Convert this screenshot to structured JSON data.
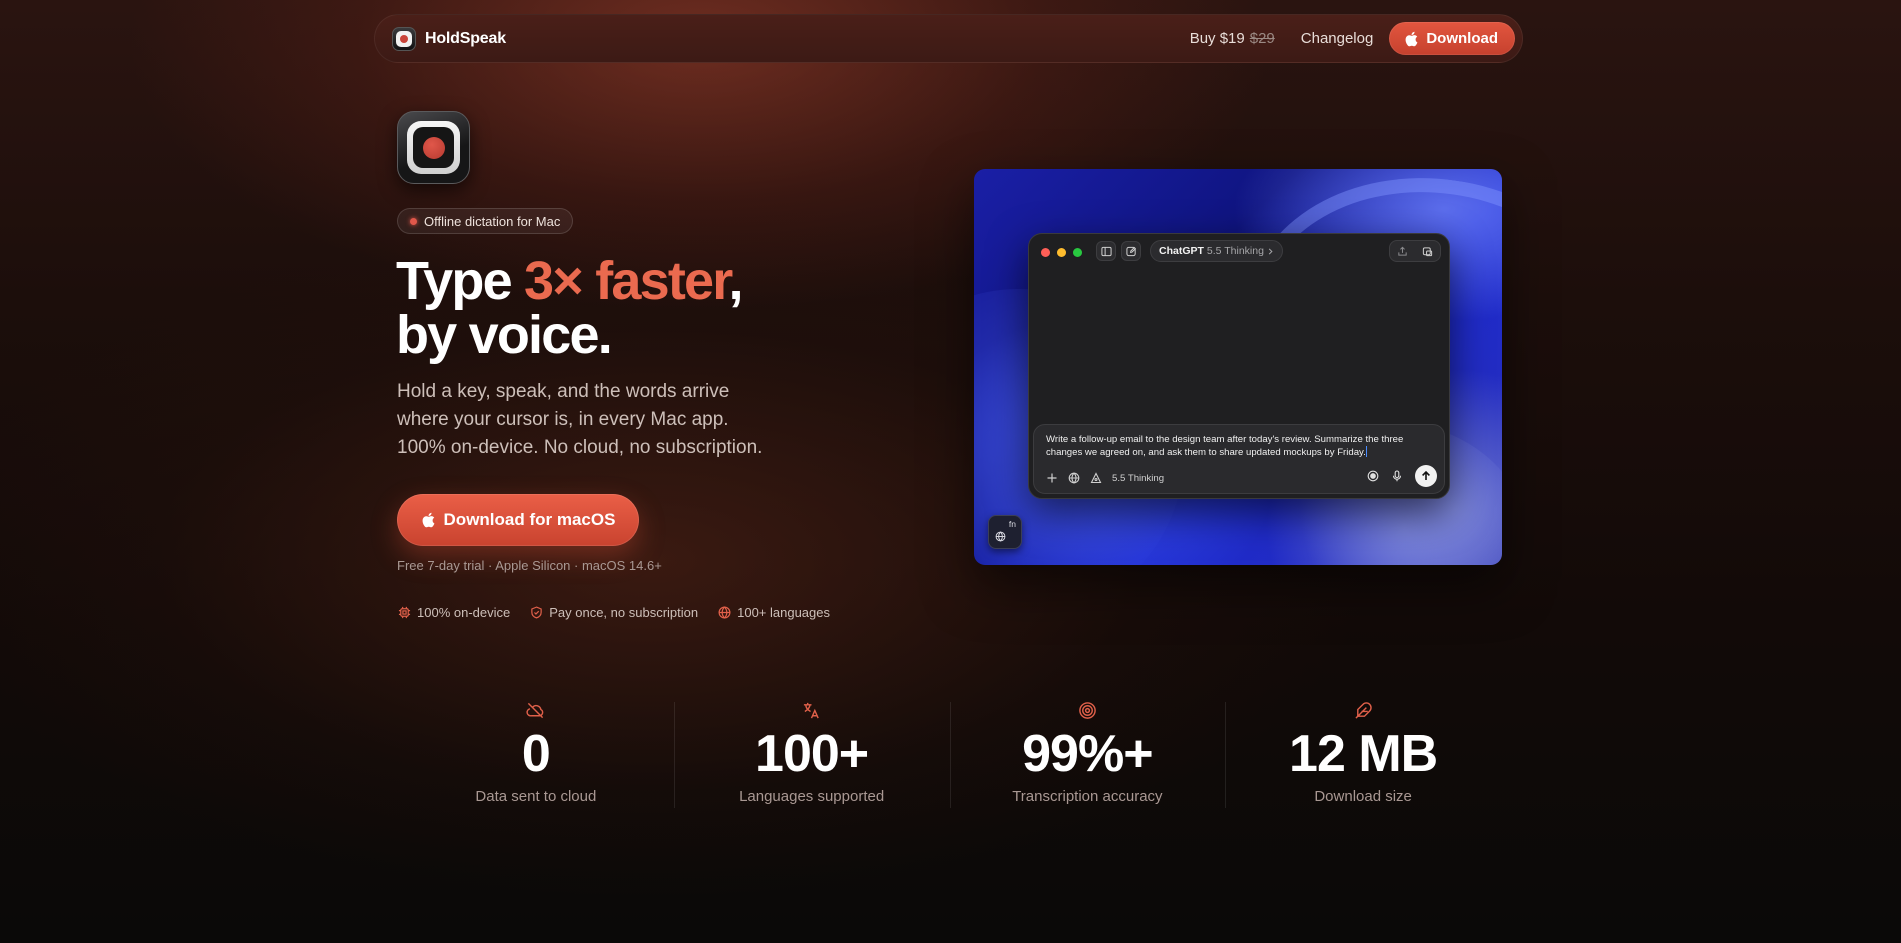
{
  "nav": {
    "brand": "HoldSpeak",
    "buy_label": "Buy $19",
    "old_price": "$29",
    "changelog": "Changelog",
    "download": "Download"
  },
  "hero": {
    "badge": "Offline dictation for Mac",
    "headline_part1": "Type ",
    "headline_accent": "3× faster",
    "headline_part2": ",",
    "headline_line2": "by voice.",
    "subtitle_line1": "Hold a key, speak, and the words arrive",
    "subtitle_line2": "where your cursor is, in every Mac app.",
    "subtitle_line3": "100% on-device. No cloud, no subscription.",
    "cta": "Download for macOS",
    "trial": "Free 7-day trial · Apple Silicon · macOS 14.6+",
    "features": [
      {
        "label": "100% on-device",
        "icon": "chip-icon"
      },
      {
        "label": "Pay once, no subscription",
        "icon": "shield-check-icon"
      },
      {
        "label": "100+ languages",
        "icon": "globe-icon"
      }
    ]
  },
  "demo": {
    "app_name": "ChatGPT",
    "model": "5.5 Thinking",
    "prompt_text": "Write a follow-up email to the design team after today's review. Summarize the three changes we agreed on, and ask them to share updated mockups by Friday.",
    "composer_model": "5.5 Thinking",
    "fn_label": "fn"
  },
  "stats": [
    {
      "value": "0",
      "label": "Data sent to cloud",
      "icon": "cloud-off-icon"
    },
    {
      "value": "100+",
      "label": "Languages supported",
      "icon": "translate-icon"
    },
    {
      "value": "99%+",
      "label": "Transcription accuracy",
      "icon": "target-icon"
    },
    {
      "value": "12 MB",
      "label": "Download size",
      "icon": "feather-icon"
    }
  ],
  "colors": {
    "accent": "#ea6a4f",
    "button": "#d94c37",
    "background": "#120a08"
  }
}
